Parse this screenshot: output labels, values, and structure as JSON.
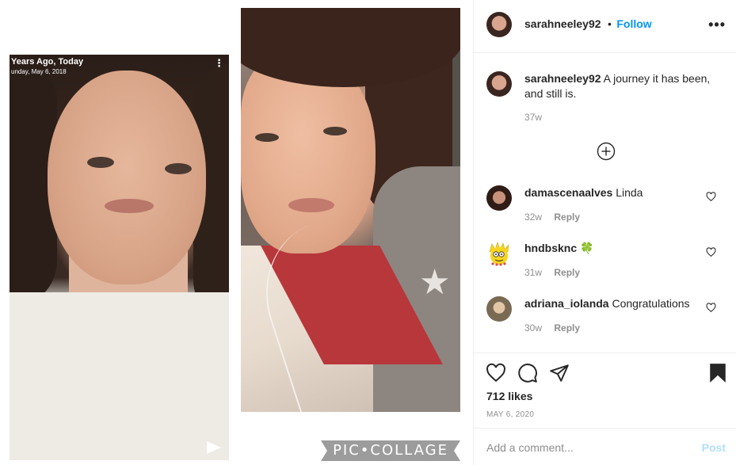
{
  "media": {
    "left_photo": {
      "caption_title": "Years Ago, Today",
      "caption_date": "unday, May 6, 2018"
    },
    "watermark": "PIC•COLLAGE"
  },
  "header": {
    "username": "sarahneeley92",
    "separator": "•",
    "follow_label": "Follow",
    "more_label": "•••"
  },
  "caption": {
    "username": "sarahneeley92",
    "text": "A journey it has been, and still is.",
    "age": "37w"
  },
  "comments": [
    {
      "username": "damascenaalves",
      "text": "Linda",
      "age": "32w",
      "reply_label": "Reply",
      "avatar_icon": "profile-photo"
    },
    {
      "username": "hndbsknc",
      "text": "🍀",
      "age": "31w",
      "reply_label": "Reply",
      "avatar_icon": "cartoon-avatar"
    },
    {
      "username": "adriana_iolanda",
      "text": "Congratulations",
      "age": "30w",
      "reply_label": "Reply",
      "avatar_icon": "profile-photo"
    }
  ],
  "actions": {
    "icons": [
      "heart-icon",
      "comment-icon",
      "share-icon",
      "bookmark-icon"
    ],
    "likes": "712 likes",
    "date": "MAY 6, 2020"
  },
  "add_comment": {
    "placeholder": "Add a comment...",
    "post_label": "Post"
  },
  "colors": {
    "link_blue": "#0095f6",
    "post_disabled": "#b2dffc",
    "muted": "#8e8e8e",
    "text": "#262626"
  }
}
